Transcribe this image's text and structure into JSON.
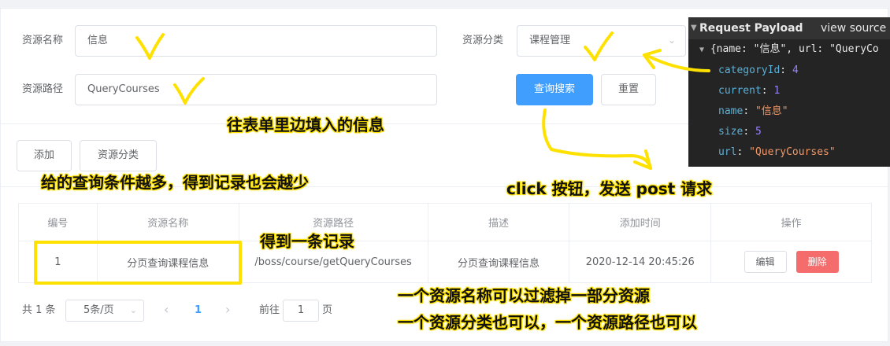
{
  "form": {
    "name_label": "资源名称",
    "name_value": "信息",
    "category_label": "资源分类",
    "category_value": "课程管理",
    "path_label": "资源路径",
    "path_value": "QueryCourses",
    "search_label": "查询搜索",
    "reset_label": "重置"
  },
  "toolbar": {
    "add_label": "添加",
    "category_label": "资源分类"
  },
  "table": {
    "headers": [
      "编号",
      "资源名称",
      "资源路径",
      "描述",
      "添加时间",
      "操作"
    ],
    "rows": [
      {
        "id": "1",
        "name": "分页查询课程信息",
        "path": "/boss/course/getQueryCourses",
        "desc": "分页查询课程信息",
        "time": "2020-12-14 20:45:26",
        "edit": "编辑",
        "delete": "删除"
      }
    ]
  },
  "pagination": {
    "total": "共 1 条",
    "page_size": "5条/页",
    "prev": "‹",
    "current": "1",
    "next": "›",
    "goto_prefix": "前往",
    "goto_value": "1",
    "goto_suffix": "页"
  },
  "devtools": {
    "title": "Request Payload",
    "view_source": "view source",
    "summary": "{name: \"信息\", url: \"QueryCo",
    "fields": [
      {
        "key": "categoryId",
        "value": "4",
        "type": "number"
      },
      {
        "key": "current",
        "value": "1",
        "type": "number"
      },
      {
        "key": "name",
        "value": "\"信息\"",
        "type": "string"
      },
      {
        "key": "size",
        "value": "5",
        "type": "number"
      },
      {
        "key": "url",
        "value": "\"QueryCourses\"",
        "type": "string"
      }
    ]
  },
  "annotations": {
    "fill_form": "往表单里边填入的信息",
    "more_conditions": "给的查询条件越多，得到记录也会越少",
    "click_button": "click 按钮，发送 post 请求",
    "one_record": "得到一条记录",
    "filter_name": "一个资源名称可以过滤掉一部分资源",
    "filter_other": "一个资源分类也可以，一个资源路径也可以"
  },
  "colors": {
    "primary": "#409eff",
    "danger": "#f56c6c",
    "highlight": "#ffe100"
  }
}
